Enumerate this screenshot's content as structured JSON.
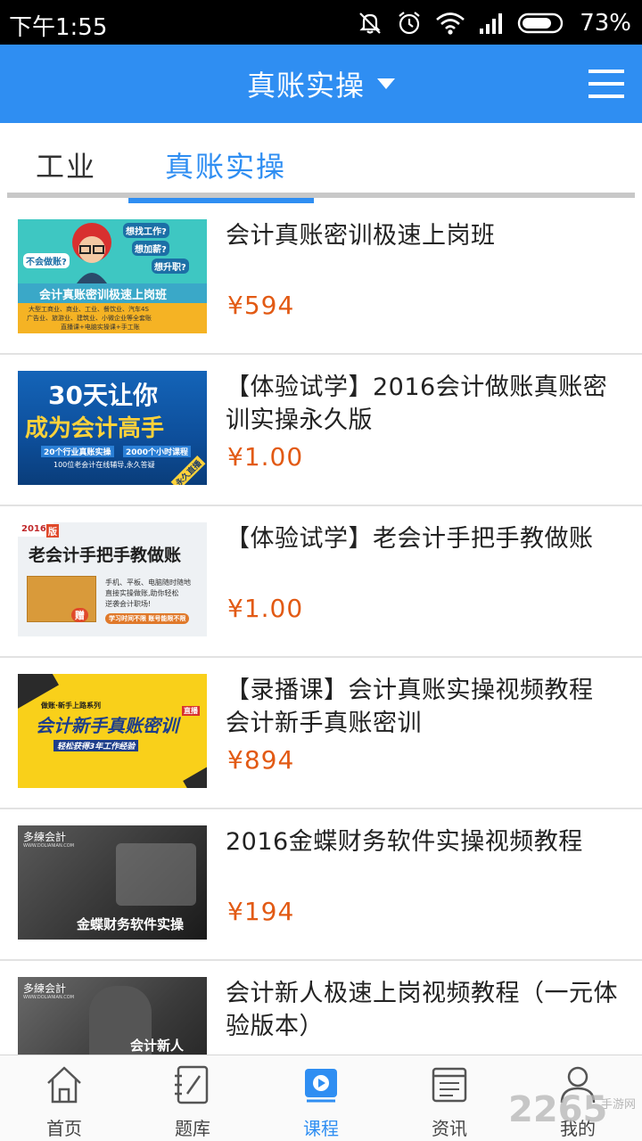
{
  "status_bar": {
    "time": "下午1:55",
    "battery": "73%"
  },
  "header": {
    "title": "真账实操"
  },
  "tabs": [
    {
      "label": "工业"
    },
    {
      "label": "真账实操"
    }
  ],
  "courses": [
    {
      "title": "会计真账密训极速上岗班",
      "price": "¥594",
      "thumb": {
        "banner": "会计真账密训极速上岗班",
        "bubble_1": "想找工作?",
        "bubble_2": "想加薪?",
        "bubble_3": "想升职?",
        "bubble_4": "不会做账?",
        "line_1": "大型工商业、商业、工业、餐饮业、汽车4S",
        "line_2": "广告业、旅游业、建筑业、小微企业等全套账",
        "line_3": "直播课+电脑实操课+手工账"
      }
    },
    {
      "title": "【体验试学】2016会计做账真账密训实操永久版",
      "price": "¥1.00",
      "thumb": {
        "big_1": "30天让你",
        "big_2": "成为会计高手",
        "sub_1": "20个行业真账实操",
        "sub_2": "2000个小时课程",
        "sub_3": "100位老会计在线辅导,永久答疑",
        "corner": "永久直播"
      }
    },
    {
      "title": "【体验试学】老会计手把手教做账",
      "price": "¥1.00",
      "thumb": {
        "year": "2016",
        "year_suffix": "版",
        "headline": "老会计手把手教做账",
        "desc_1": "手机、平板、电脑随时随地",
        "desc_2": "直接实操做账,助你轻松",
        "desc_3": "逆袭会计职场!",
        "pill": "学习时间不限 账号能限不限",
        "gift": "赠"
      }
    },
    {
      "title": "【录播课】会计真账实操视频教程 会计新手真账密训",
      "price": "¥894",
      "thumb": {
        "small": "做账·新手上路系列",
        "headline": "会计新手真账密训",
        "tag": "直播",
        "sub": "轻松获得3年工作经验"
      }
    },
    {
      "title": "2016金蝶财务软件实操视频教程",
      "price": "¥194",
      "thumb": {
        "logo": "多練会計",
        "url": "WWW.DOLIANIAN.COM",
        "caption": "金蝶财务软件实操"
      }
    },
    {
      "title": "会计新人极速上岗视频教程（一元体验版本）",
      "price": "",
      "thumb": {
        "logo": "多練会計",
        "url": "WWW.DOLIANIAN.COM",
        "caption": "会计新人"
      }
    }
  ],
  "bottom_nav": [
    {
      "label": "首页",
      "icon": "home-icon"
    },
    {
      "label": "题库",
      "icon": "notebook-icon"
    },
    {
      "label": "课程",
      "icon": "video-icon",
      "active": true
    },
    {
      "label": "资讯",
      "icon": "news-icon"
    },
    {
      "label": "我的",
      "icon": "user-icon"
    }
  ],
  "watermark": {
    "text": "2265",
    "sub": "手游网"
  },
  "colors": {
    "accent": "#2f8ef2",
    "price": "#e25a14",
    "header_bg": "#2f8ef2"
  }
}
